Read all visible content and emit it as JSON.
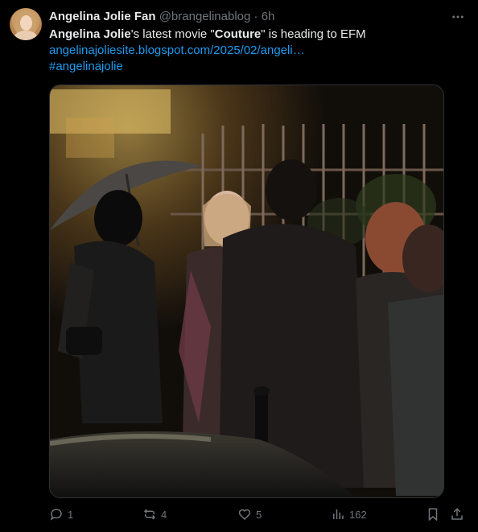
{
  "tweet": {
    "author_name": "Angelina Jolie Fan",
    "handle": "@brangelinablog",
    "separator": "·",
    "time": "6h",
    "text": {
      "bold_name": "Angelina Jolie",
      "part1": "'s latest movie \"",
      "bold_title": "Couture",
      "part2": "\" is heading to EFM"
    },
    "link_text": "angelinajoliesite.blogspot.com/2025/02/angeli…",
    "hashtag": "#angelinajolie"
  },
  "actions": {
    "reply_count": "1",
    "retweet_count": "4",
    "like_count": "5",
    "views_count": "162"
  },
  "colors": {
    "background": "#000000",
    "text": "#e7e9ea",
    "secondary": "#71767b",
    "link": "#1d9bf0"
  },
  "icons": [
    "more-icon",
    "reply-icon",
    "retweet-icon",
    "like-icon",
    "views-icon",
    "bookmark-icon",
    "share-icon"
  ]
}
